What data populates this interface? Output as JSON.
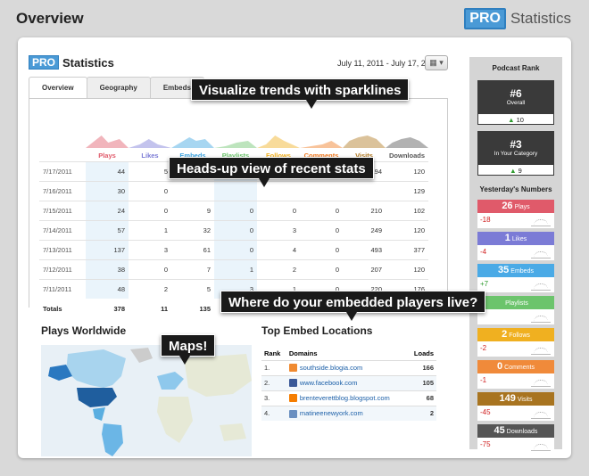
{
  "outer": {
    "title": "Overview",
    "brand_pro": "PRO",
    "brand_text": "Statistics"
  },
  "app": {
    "pro": "PRO",
    "title": "Statistics",
    "date_range": "July 11, 2011 - July 17, 2011"
  },
  "tabs": [
    {
      "label": "Overview",
      "active": true
    },
    {
      "label": "Geography",
      "active": false
    },
    {
      "label": "Embeds",
      "active": false
    }
  ],
  "table": {
    "columns": [
      {
        "label": "Plays",
        "color": "#e05a6a"
      },
      {
        "label": "Likes",
        "color": "#7b7bd6"
      },
      {
        "label": "Embeds",
        "color": "#3ba3e0"
      },
      {
        "label": "Playlists",
        "color": "#6cc46c"
      },
      {
        "label": "Follows",
        "color": "#f0b020"
      },
      {
        "label": "Comments",
        "color": "#f07a20"
      },
      {
        "label": "Visits",
        "color": "#b07820"
      },
      {
        "label": "Downloads",
        "color": "#555555"
      }
    ],
    "rows": [
      {
        "date": "7/17/2011",
        "cells": [
          "44",
          "5",
          "12",
          "0",
          "4",
          "1",
          "194",
          "120"
        ]
      },
      {
        "date": "7/16/2011",
        "cells": [
          "30",
          "0",
          "",
          "",
          "",
          "",
          "",
          "129"
        ]
      },
      {
        "date": "7/15/2011",
        "cells": [
          "24",
          "0",
          "9",
          "0",
          "0",
          "0",
          "210",
          "102"
        ]
      },
      {
        "date": "7/14/2011",
        "cells": [
          "57",
          "1",
          "32",
          "0",
          "3",
          "0",
          "249",
          "120"
        ]
      },
      {
        "date": "7/13/2011",
        "cells": [
          "137",
          "3",
          "61",
          "0",
          "4",
          "0",
          "493",
          "377"
        ]
      },
      {
        "date": "7/12/2011",
        "cells": [
          "38",
          "0",
          "7",
          "1",
          "2",
          "0",
          "207",
          "120"
        ]
      },
      {
        "date": "7/11/2011",
        "cells": [
          "48",
          "2",
          "5",
          "3",
          "1",
          "0",
          "220",
          "176"
        ]
      }
    ],
    "totals_label": "Totals",
    "totals": [
      "378",
      "11",
      "135",
      "",
      "",
      "",
      "",
      ""
    ]
  },
  "callouts": {
    "sparklines": "Visualize trends with sparklines",
    "headsup": "Heads-up view of recent stats",
    "embedded": "Where do your embedded players live?",
    "maps": "Maps!"
  },
  "plays_worldwide": {
    "title": "Plays Worldwide"
  },
  "embed_locations": {
    "title": "Top Embed Locations",
    "headers": {
      "rank": "Rank",
      "domains": "Domains",
      "loads": "Loads"
    },
    "rows": [
      {
        "rank": "1.",
        "domain": "southside.blogia.com",
        "loads": "166",
        "icon": "blogia-icon",
        "icon_color": "#f08a30"
      },
      {
        "rank": "2.",
        "domain": "www.facebook.com",
        "loads": "105",
        "icon": "facebook-icon",
        "icon_color": "#3b5998"
      },
      {
        "rank": "3.",
        "domain": "brenteverettblog.blogspot.com",
        "loads": "68",
        "icon": "blogger-icon",
        "icon_color": "#f57d00"
      },
      {
        "rank": "4.",
        "domain": "matineenewyork.com",
        "loads": "2",
        "icon": "globe-icon",
        "icon_color": "#6a8fc0"
      }
    ]
  },
  "podcast_rank": {
    "title": "Podcast Rank",
    "overall": {
      "rank": "#6",
      "label": "Overall",
      "change": "10"
    },
    "category": {
      "rank": "#3",
      "label": "In Your Category",
      "change": "9"
    }
  },
  "yesterday": {
    "title": "Yesterday's Numbers",
    "items": [
      {
        "value": "26",
        "label": "Plays",
        "delta": "-18",
        "color": "#e05a6a",
        "delta_color": "#d02020"
      },
      {
        "value": "1",
        "label": "Likes",
        "delta": "-4",
        "color": "#7b7bd6",
        "delta_color": "#d02020"
      },
      {
        "value": "35",
        "label": "Embeds",
        "delta": "+7",
        "color": "#4aaae6",
        "delta_color": "#2e9b2e"
      },
      {
        "value": "",
        "label": "Playlists",
        "delta": "",
        "color": "#6cc46c",
        "delta_color": "#2e9b2e"
      },
      {
        "value": "2",
        "label": "Follows",
        "delta": "-2",
        "color": "#f0b020",
        "delta_color": "#d02020"
      },
      {
        "value": "0",
        "label": "Comments",
        "delta": "-1",
        "color": "#f08a3a",
        "delta_color": "#d02020"
      },
      {
        "value": "149",
        "label": "Visits",
        "delta": "-45",
        "color": "#a87420",
        "delta_color": "#d02020"
      },
      {
        "value": "45",
        "label": "Downloads",
        "delta": "-75",
        "color": "#555555",
        "delta_color": "#d02020"
      }
    ]
  }
}
